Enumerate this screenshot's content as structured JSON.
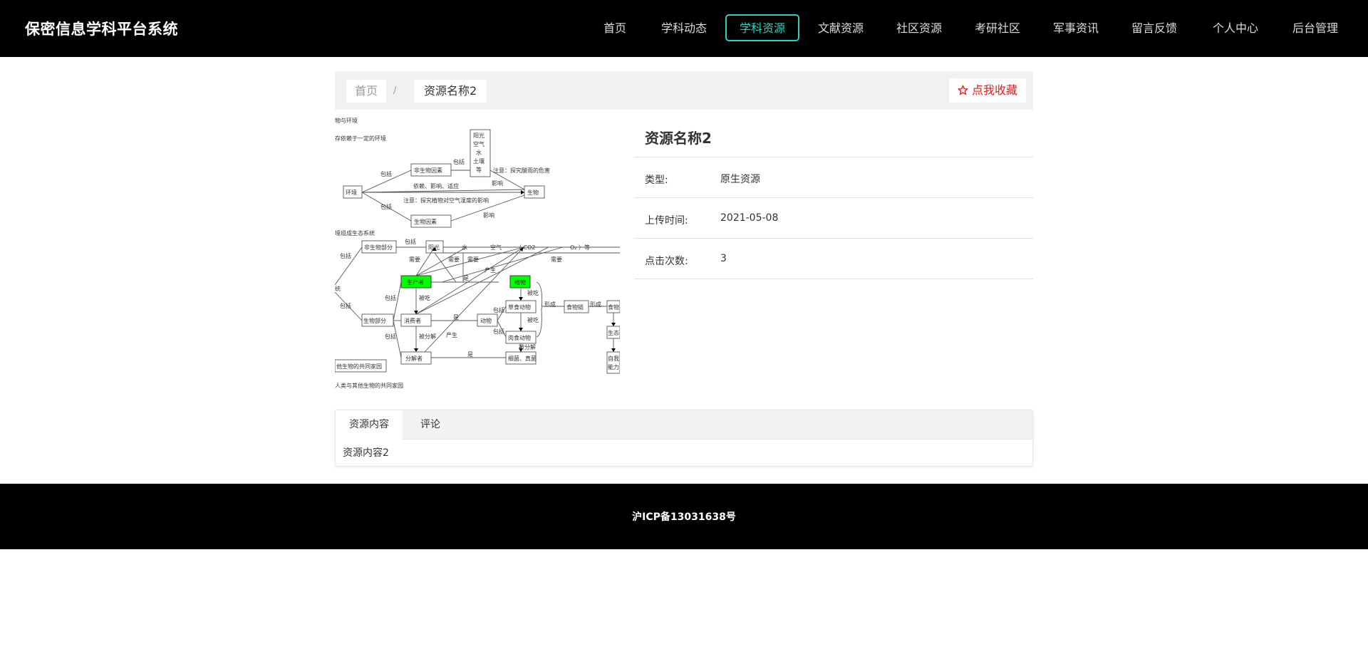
{
  "header": {
    "brand": "保密信息学科平台系统",
    "nav": [
      "首页",
      "学科动态",
      "学科资源",
      "文献资源",
      "社区资源",
      "考研社区",
      "军事资讯",
      "留言反馈",
      "个人中心",
      "后台管理"
    ],
    "active_index": 2,
    "active_color": "#2bd0c0"
  },
  "breadcrumb": {
    "home": "首页",
    "separator": "/",
    "current": "资源名称2"
  },
  "favorite": {
    "icon": "star-outline-icon",
    "label": "点我收藏",
    "color": "#e01e1e"
  },
  "resource": {
    "title": "资源名称2",
    "fields": [
      {
        "label": "类型:",
        "value": "原生资源"
      },
      {
        "label": "上传时间:",
        "value": "2021-05-08"
      },
      {
        "label": "点击次数:",
        "value": "3"
      }
    ]
  },
  "diagram": {
    "heading1": "物与环境",
    "heading1_sub": "存依赖于一定的环境",
    "abiotic_box": "非生物因素",
    "abiotic_list": [
      "阳光",
      "空气",
      "水",
      "土壤",
      "等"
    ],
    "env": "环境",
    "organism": "生物",
    "biotic_box": "生物因素",
    "include": "包括",
    "relation": "依赖、影响、适应",
    "note1": "注意：探究酸雨的危害",
    "note2": "注意：探究植物对空气湿度的影响",
    "influence": "影响",
    "heading2": "境组成生态系统",
    "nonbio_part": "非生物部分",
    "bio_part": "生物部分",
    "ecosys_left": "统",
    "sunlight": "阳光",
    "water": "水",
    "air": "空气",
    "co2": "（ CO2",
    "o2": "O₂ ）等",
    "need": "需要",
    "produce": "产生",
    "producer": "生产者",
    "plant": "植物",
    "is": "是",
    "eaten": "被吃",
    "consumer": "消费者",
    "animal": "动物",
    "herbivore": "草食动物",
    "carnivore": "肉食动物",
    "decompose": "被分解",
    "decomposer": "分解者",
    "bacteria": "细菌、真菌",
    "form": "形成",
    "food_chain": "食物链",
    "food_web": "食物",
    "eco": "生态",
    "self": "自我",
    "ability": "能力",
    "home1": "他生物的共同家园",
    "home2": "人类与其他生物的共同家园",
    "highlight_color": "#00ff00"
  },
  "tabs": {
    "items": [
      "资源内容",
      "评论"
    ],
    "active_index": 0,
    "content": "资源内容2"
  },
  "footer": {
    "icp": "沪ICP备13031638号"
  }
}
